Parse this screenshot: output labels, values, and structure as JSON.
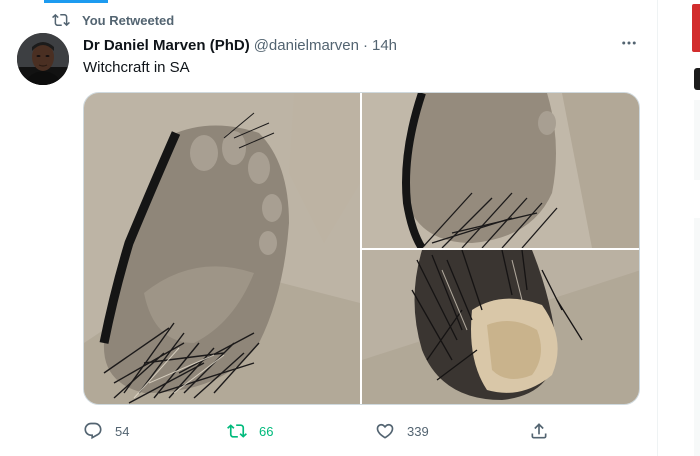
{
  "social_context": {
    "text": "You Retweeted",
    "icon": "retweet-icon"
  },
  "tweet": {
    "author": {
      "display_name": "Dr Daniel Marven (PhD)",
      "handle": "@danielmarven",
      "separator": "·",
      "timestamp": "14h"
    },
    "text": "Witchcraft in SA",
    "media_count": 3
  },
  "actions": {
    "reply": {
      "icon": "reply-icon",
      "count": "54"
    },
    "retweet": {
      "icon": "retweet-icon",
      "count": "66",
      "active": true,
      "color": "#00ba7c"
    },
    "like": {
      "icon": "heart-icon",
      "count": "339"
    },
    "share": {
      "icon": "share-icon"
    }
  },
  "colors": {
    "accent": "#1d9bf0",
    "secondary_text": "#536471",
    "primary_text": "#0f1419",
    "retweet_active": "#00ba7c"
  }
}
